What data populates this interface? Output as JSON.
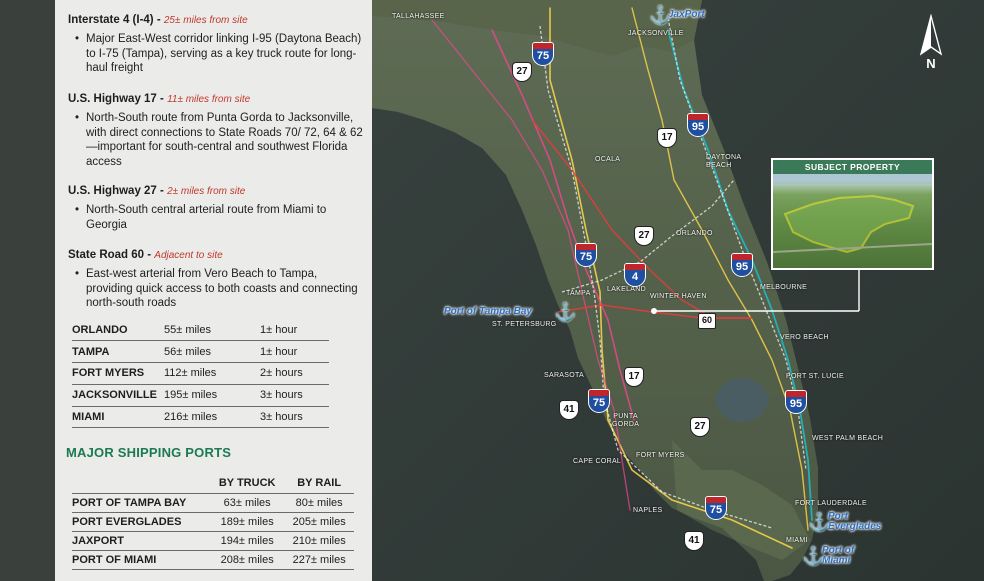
{
  "routes": [
    {
      "name": "Interstate 4 (I-4) -",
      "distance": "25± miles from site",
      "desc": "Major East-West corridor linking I-95 (Daytona Beach) to I-75 (Tampa), serving as a key truck route for long-haul freight"
    },
    {
      "name": "U.S. Highway 17 -",
      "distance": "11± miles from site",
      "desc": "North-South route from Punta Gorda to Jacksonville, with direct connections to State Roads 70/ 72, 64 & 62—important for south-central and southwest Florida access"
    },
    {
      "name": "U.S. Highway 27 -",
      "distance": "2± miles from site",
      "desc": "North-South central arterial route from Miami to Georgia"
    },
    {
      "name": "State Road 60 -",
      "distance": "Adjacent to site",
      "desc": "East-west arterial from Vero Beach to Tampa, providing quick access to both coasts and connecting north-south roads"
    }
  ],
  "distances": [
    {
      "city": "ORLANDO",
      "miles": "55± miles",
      "time": "1± hour"
    },
    {
      "city": "TAMPA",
      "miles": "56± miles",
      "time": "1± hour"
    },
    {
      "city": "FORT MYERS",
      "miles": "112± miles",
      "time": "2± hours"
    },
    {
      "city": "JACKSONVILLE",
      "miles": "195± miles",
      "time": "3± hours"
    },
    {
      "city": "MIAMI",
      "miles": "216± miles",
      "time": "3± hours"
    }
  ],
  "ports": {
    "title": "MAJOR SHIPPING PORTS",
    "col_truck": "BY TRUCK",
    "col_rail": "BY RAIL",
    "rows": [
      {
        "port": "PORT OF TAMPA BAY",
        "truck": "63± miles",
        "rail": "80± miles"
      },
      {
        "port": "PORT EVERGLADES",
        "truck": "189± miles",
        "rail": "205± miles"
      },
      {
        "port": "JAXPORT",
        "truck": "194± miles",
        "rail": "210± miles"
      },
      {
        "port": "PORT OF MIAMI",
        "truck": "208± miles",
        "rail": "227± miles"
      }
    ]
  },
  "map": {
    "cities": {
      "tallahassee": "TALLAHASSEE",
      "jacksonville": "JACKSONVILLE",
      "ocala": "OCALA",
      "daytona": "DAYTONA\nBEACH",
      "orlando": "ORLANDO",
      "tampa": "TAMPA",
      "lakeland": "LAKELAND",
      "winter_haven": "WINTER HAVEN",
      "st_pete": "ST. PETERSBURG",
      "melbourne": "MELBOURNE",
      "vero": "VERO BEACH",
      "port_st_lucie": "PORT ST. LUCIE",
      "sarasota": "SARASOTA",
      "punta_gorda": "PUNTA\nGORDA",
      "wpb": "WEST PALM BEACH",
      "cape_coral": "CAPE CORAL",
      "fort_myers": "FORT MYERS",
      "naples": "NAPLES",
      "fort_lauderdale": "FORT LAUDERDALE",
      "miami": "MIAMI"
    },
    "ports": {
      "jax": "JaxPort",
      "tampa_bay": "Port of Tampa Bay",
      "everglades": "Port\nEverglades",
      "miami": "Port of\nMiami"
    },
    "shields": {
      "i75": "75",
      "i95": "95",
      "i4": "4",
      "us27": "27",
      "us17": "17",
      "us41": "41",
      "sr60": "60",
      "interstate_top": "INTERSTATE"
    },
    "inset_title": "SUBJECT PROPERTY",
    "north": "N"
  },
  "colors": {
    "accent_green": "#1b7a53",
    "distance_red": "#c0392b",
    "port_blue": "#2d6ec2",
    "property_yellow": "#f4ec2a",
    "interstate_blue": "#1f4fa0",
    "interstate_red": "#c0252b"
  }
}
